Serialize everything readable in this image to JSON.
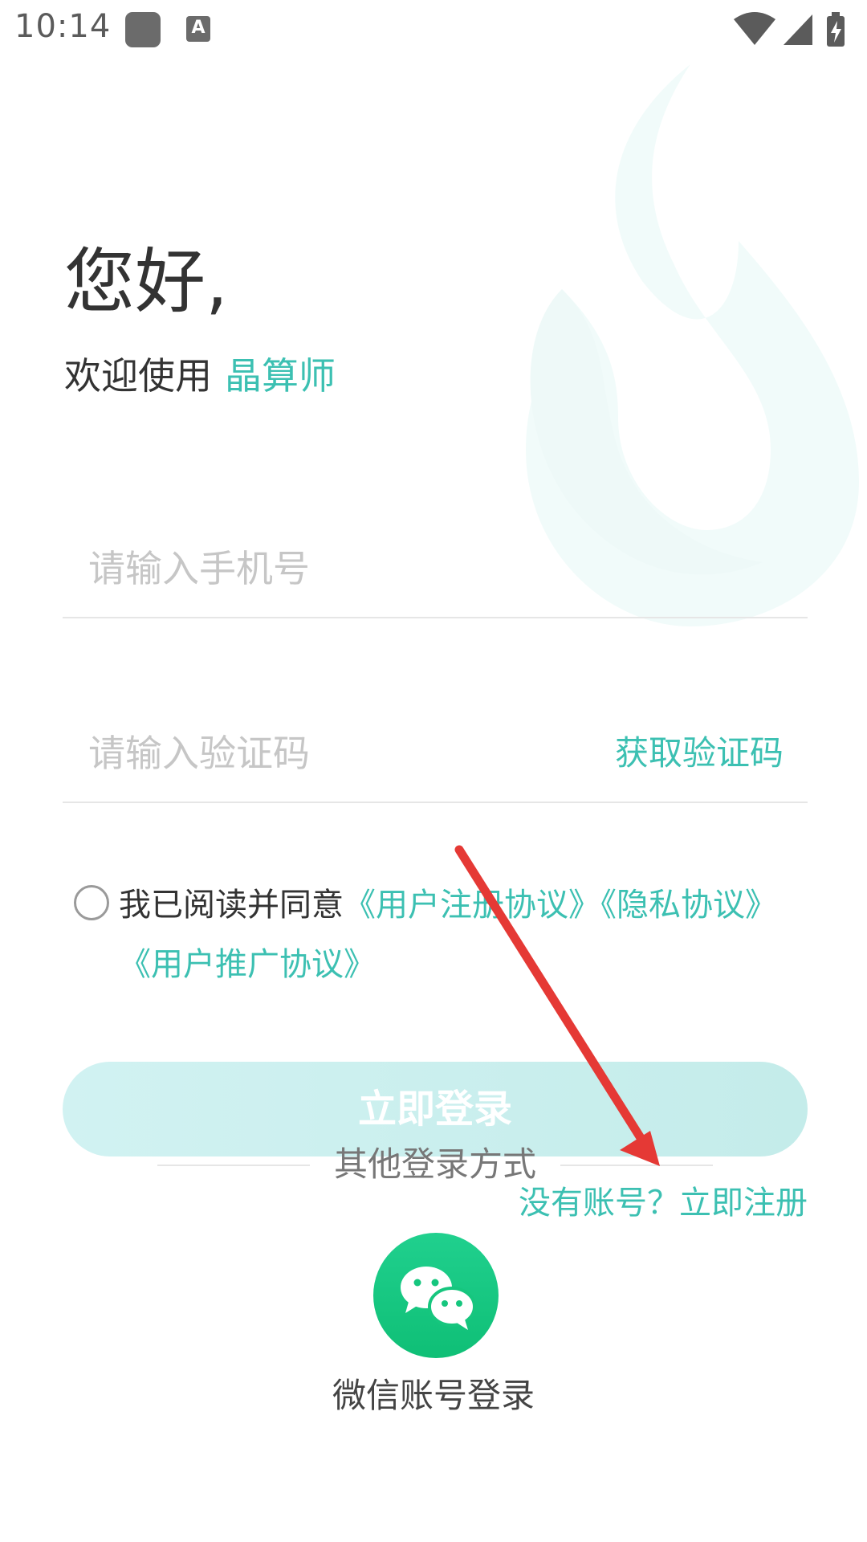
{
  "status_bar": {
    "time": "10:14"
  },
  "header": {
    "greeting": "您好,",
    "welcome_prefix": "欢迎使用",
    "brand_name": "晶算师"
  },
  "form": {
    "phone_placeholder": "请输入手机号",
    "phone_value": "",
    "code_placeholder": "请输入验证码",
    "code_value": "",
    "get_code_label": "获取验证码"
  },
  "agreement": {
    "checked": false,
    "prefix": "我已阅读并同意",
    "link_user_register": "《用户注册协议》",
    "link_privacy": "《隐私协议》",
    "link_promotion": "《用户推广协议》"
  },
  "login_button": {
    "label": "立即登录"
  },
  "other_login": {
    "label": "其他登录方式"
  },
  "register": {
    "label": "没有账号？立即注册"
  },
  "wechat": {
    "label": "微信账号登录"
  },
  "colors": {
    "accent": "#3cc0b2",
    "wechat": "#16c67e",
    "annotation_arrow": "#e53935"
  }
}
